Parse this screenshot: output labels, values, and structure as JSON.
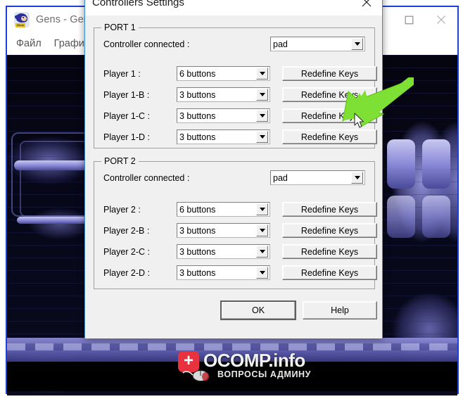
{
  "app_window": {
    "title": "Gens - Genesis : ROCK N' ROLL RACING",
    "icon": "sonic-icon",
    "controls": {
      "minimize": "minimize-icon",
      "maximize": "maximize-icon",
      "close": "close-icon"
    },
    "menu": [
      {
        "label": "Файл"
      },
      {
        "label": "Графика"
      }
    ]
  },
  "dialog": {
    "title": "Controllers Settings",
    "close_icon": "close-icon",
    "ports": [
      {
        "legend": "PORT 1",
        "connected_label": "Controller connected :",
        "connected_value": "pad",
        "rows": [
          {
            "label": "Player 1   :",
            "value": "6 buttons",
            "button": "Redefine Keys"
          },
          {
            "label": "Player 1-B :",
            "value": "3 buttons",
            "button": "Redefine Keys"
          },
          {
            "label": "Player 1-C :",
            "value": "3 buttons",
            "button": "Redefine Keys"
          },
          {
            "label": "Player 1-D :",
            "value": "3 buttons",
            "button": "Redefine Keys"
          }
        ]
      },
      {
        "legend": "PORT 2",
        "connected_label": "Controller connected :",
        "connected_value": "pad",
        "rows": [
          {
            "label": "Player 2   :",
            "value": "6 buttons",
            "button": "Redefine Keys"
          },
          {
            "label": "Player 2-B :",
            "value": "3 buttons",
            "button": "Redefine Keys"
          },
          {
            "label": "Player 2-C :",
            "value": "3 buttons",
            "button": "Redefine Keys"
          },
          {
            "label": "Player 2-D :",
            "value": "3 buttons",
            "button": "Redefine Keys"
          }
        ]
      }
    ],
    "footer": {
      "ok_label": "OK",
      "help_label": "Help"
    }
  },
  "annotation": {
    "arrow_color": "#7ee035",
    "arrow_target": "redefine-keys-player-1"
  },
  "watermark": {
    "main": "OCOMP.info",
    "sub": "ВОПРОСЫ АДМИНУ",
    "plus": "+",
    "badge_color": "#e8333f"
  }
}
